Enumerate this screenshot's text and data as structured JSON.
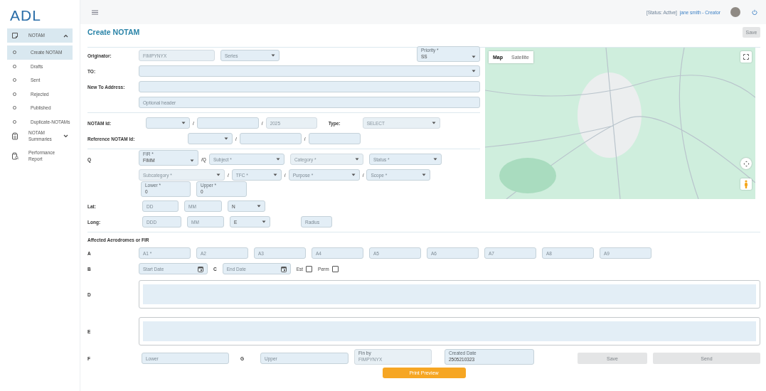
{
  "sidebar": {
    "logo": "ADL",
    "items": [
      {
        "label": "NOTAM",
        "expanded": true,
        "selected": false,
        "children": [
          {
            "label": "Create NOTAM",
            "selected": true
          },
          {
            "label": "Drafts",
            "selected": false
          },
          {
            "label": "Sent",
            "selected": false
          },
          {
            "label": "Rejected",
            "selected": false
          },
          {
            "label": "Published",
            "selected": false
          },
          {
            "label": "Duplicate-NOTAMs",
            "selected": false
          }
        ]
      },
      {
        "label": "NOTAM Summaries",
        "expanded": false,
        "selected": false
      },
      {
        "label": "Performance Report",
        "selected": false
      }
    ]
  },
  "header": {
    "status": "[Status: Active]",
    "user": "jane smith - Creator"
  },
  "page": {
    "title": "Create NOTAM",
    "save": {
      "label": "Save",
      "disabled": true
    }
  },
  "form": {
    "groups": [
      {
        "rows": [
          {
            "label": "Originator:",
            "items": [
              {
                "kind": "input",
                "value": "FIMPYNYX",
                "disabled": true
              },
              {
                "kind": "select",
                "placeholder": "Series",
                "disabled": false
              },
              {
                "kind": "select",
                "float_label": "Priority *",
                "value": "SS",
                "disabled": false
              }
            ]
          },
          {
            "label": "TO:",
            "items": [
              {
                "kind": "select",
                "disabled": false
              }
            ]
          },
          {
            "label": "New To Address:",
            "items": [
              {
                "kind": "input",
                "disabled": false
              }
            ]
          },
          {
            "items": [
              {
                "kind": "input",
                "placeholder": "Optional header",
                "disabled": false
              }
            ]
          }
        ]
      },
      {
        "rows": [
          {
            "label": "NOTAM Id:",
            "items": [
              {
                "kind": "select",
                "disabled": false
              },
              {
                "kind": "sep",
                "text": "/"
              },
              {
                "kind": "input",
                "disabled": false
              },
              {
                "kind": "sep",
                "text": "/"
              },
              {
                "kind": "input",
                "value": "2025",
                "disabled": true
              },
              {
                "kind": "label",
                "text": "Type:"
              },
              {
                "kind": "select",
                "value": "SELECT",
                "disabled": true
              }
            ]
          },
          {
            "label": "Reference NOTAM Id:",
            "items": [
              {
                "kind": "select",
                "disabled": false
              },
              {
                "kind": "sep",
                "text": "/"
              },
              {
                "kind": "input",
                "disabled": false
              },
              {
                "kind": "sep",
                "text": "/"
              },
              {
                "kind": "input",
                "disabled": false
              }
            ]
          }
        ]
      },
      {
        "rows": [
          {
            "label": "Q",
            "items": [
              {
                "kind": "select",
                "float_label": "FIR *",
                "value": "FIMM",
                "disabled": false
              },
              {
                "kind": "sep",
                "text": "/Q"
              },
              {
                "kind": "select",
                "placeholder": "Subject *",
                "disabled": false
              },
              {
                "kind": "select",
                "placeholder": "Category *",
                "disabled": true
              },
              {
                "kind": "select",
                "placeholder": "Status *",
                "disabled": false
              }
            ]
          },
          {
            "items": [
              {
                "kind": "select",
                "placeholder": "Subcategory *",
                "disabled": true
              },
              {
                "kind": "sep",
                "text": "/"
              },
              {
                "kind": "select",
                "placeholder": "TFC *",
                "disabled": false
              },
              {
                "kind": "sep",
                "text": "/"
              },
              {
                "kind": "select",
                "placeholder": "Purpose *",
                "disabled": false
              },
              {
                "kind": "sep",
                "text": "/"
              },
              {
                "kind": "select",
                "placeholder": "Scope *",
                "disabled": false
              }
            ]
          },
          {
            "items": [
              {
                "kind": "input",
                "float_label": "Lower *",
                "value": "0",
                "disabled": false
              },
              {
                "kind": "input",
                "float_label": "Upper *",
                "value": "0",
                "disabled": false
              }
            ]
          },
          {
            "label": "Lat:",
            "items": [
              {
                "kind": "input",
                "placeholder": "DD",
                "disabled": false
              },
              {
                "kind": "input",
                "placeholder": "MM",
                "disabled": false
              },
              {
                "kind": "select",
                "value": "N",
                "disabled": false
              }
            ]
          },
          {
            "label": "Long:",
            "items": [
              {
                "kind": "input",
                "placeholder": "DDD",
                "disabled": false
              },
              {
                "kind": "input",
                "placeholder": "MM",
                "disabled": false
              },
              {
                "kind": "select",
                "value": "E",
                "disabled": false
              },
              {
                "kind": "input",
                "placeholder": "Radius",
                "disabled": false
              }
            ]
          }
        ]
      }
    ],
    "map": {
      "tabs": [
        {
          "label": "Map",
          "selected": true
        },
        {
          "label": "Satellite",
          "selected": false
        }
      ]
    },
    "affected": {
      "heading": "Affected Aerodromes or FIR",
      "rows": [
        {
          "label": "A",
          "items": [
            {
              "kind": "input",
              "placeholder": "A1 *",
              "disabled": false
            },
            {
              "kind": "input",
              "placeholder": "A2",
              "disabled": false
            },
            {
              "kind": "input",
              "placeholder": "A3",
              "disabled": false
            },
            {
              "kind": "input",
              "placeholder": "A4",
              "disabled": false
            },
            {
              "kind": "input",
              "placeholder": "A5",
              "disabled": false
            },
            {
              "kind": "input",
              "placeholder": "A6",
              "disabled": false
            },
            {
              "kind": "input",
              "placeholder": "A7",
              "disabled": false
            },
            {
              "kind": "input",
              "placeholder": "A8",
              "disabled": false
            },
            {
              "kind": "input",
              "placeholder": "A9",
              "disabled": false
            }
          ]
        },
        {
          "label": "B",
          "items": [
            {
              "kind": "date",
              "placeholder": "Start Date",
              "disabled": false
            },
            {
              "kind": "label",
              "text": "C"
            },
            {
              "kind": "date",
              "placeholder": "End Date",
              "disabled": false
            },
            {
              "kind": "text",
              "text": "Est"
            },
            {
              "kind": "check",
              "checked": false
            },
            {
              "kind": "text",
              "text": "Perm"
            },
            {
              "kind": "check",
              "checked": false
            }
          ]
        },
        {
          "label": "D",
          "items": [
            {
              "kind": "area"
            }
          ]
        },
        {
          "label": "E",
          "items": [
            {
              "kind": "area"
            }
          ]
        },
        {
          "label": "F",
          "items": [
            {
              "kind": "input",
              "placeholder": "Lower",
              "disabled": false
            },
            {
              "kind": "label",
              "text": "G"
            },
            {
              "kind": "input",
              "placeholder": "Upper",
              "disabled": false
            },
            {
              "kind": "input",
              "float_label": "Fin by",
              "value": "FIMPYNYX",
              "disabled": true
            },
            {
              "kind": "input",
              "float_label": "Created Date",
              "value": "2505210323",
              "disabled": false
            },
            {
              "kind": "button",
              "label": "Save",
              "disabled": true
            },
            {
              "kind": "button",
              "label": "Send",
              "disabled": true
            }
          ]
        }
      ]
    },
    "print_preview": {
      "label": "Print Preview",
      "disabled": false
    }
  }
}
